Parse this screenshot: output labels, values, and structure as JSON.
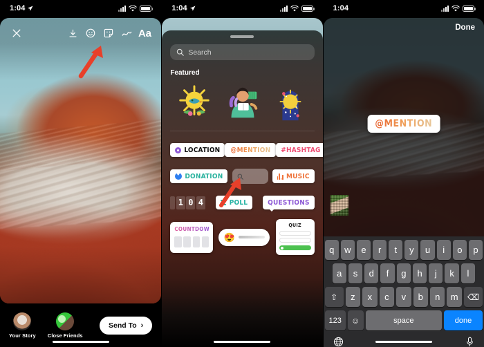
{
  "status_bar": {
    "time": "1:04",
    "location_arrow": true,
    "signal_icon": "signal-bars-icon",
    "wifi_icon": "wifi-icon",
    "battery_icon": "battery-icon"
  },
  "panel1": {
    "name": "instagram-story-editor",
    "toolbar": {
      "close_label": "✕",
      "items": [
        {
          "name": "close-icon",
          "label": "✕"
        },
        {
          "name": "download-icon",
          "label": "download"
        },
        {
          "name": "emoji-face-icon",
          "label": "emoji"
        },
        {
          "name": "sticker-icon",
          "label": "sticker"
        },
        {
          "name": "draw-squiggle-icon",
          "label": "draw"
        },
        {
          "name": "text-aa-icon",
          "label": "Aa"
        }
      ],
      "text_tool_label": "Aa"
    },
    "photo_alt": "desert rock formation with teal sky",
    "share": {
      "your_story_label": "Your Story",
      "close_friends_label": "Close Friends",
      "send_to_label": "Send To",
      "send_to_chevron": "›"
    },
    "annotation": {
      "type": "red-arrow",
      "points_to": "sticker-icon"
    }
  },
  "panel2": {
    "name": "sticker-tray",
    "search": {
      "placeholder": "Search",
      "value": "",
      "icon": "search-icon"
    },
    "section_title": "Featured",
    "featured_stickers": [
      {
        "name": "sun-bird-sticker",
        "alt": "sun with bird"
      },
      {
        "name": "reading-person-sticker",
        "alt": "person reading"
      },
      {
        "name": "celestial-sun-moon-sticker",
        "alt": "sun and moon"
      }
    ],
    "sticker_rows": [
      [
        {
          "name": "location-sticker",
          "label": "LOCATION",
          "icon": "pin-icon",
          "color": "#111111"
        },
        {
          "name": "mention-sticker",
          "label": "@MENTION",
          "color": "#e8622e",
          "highlighted": true
        },
        {
          "name": "hashtag-sticker",
          "label": "#HASHTAG",
          "color": "#ef4f74"
        }
      ],
      [
        {
          "name": "donation-sticker",
          "label": "DONATION",
          "icon": "heart-icon",
          "color": "#2bb39f"
        },
        {
          "name": "gif-search-sticker",
          "label": "",
          "icon": "search-icon"
        },
        {
          "name": "music-sticker",
          "label": "MUSIC",
          "icon": "music-bars-icon",
          "color": "#ee7239"
        }
      ],
      [
        {
          "name": "counter-sticker",
          "label": "104"
        },
        {
          "name": "poll-sticker",
          "label": "POLL",
          "icon": "poll-icon",
          "color": "#24b3a4"
        },
        {
          "name": "questions-sticker",
          "label": "QUESTIONS",
          "color": "#8e5ad6"
        }
      ]
    ],
    "counter_digits": [
      "1",
      "0",
      "4"
    ],
    "cards": {
      "countdown_label": "COUNTDOWN",
      "slider_emoji": "😍",
      "quiz_label": "QUIZ"
    },
    "annotation": {
      "type": "red-arrow",
      "points_to": "mention-sticker"
    }
  },
  "panel3": {
    "name": "mention-placed-view",
    "done_label": "Done",
    "placed_sticker_label": "@MENTION",
    "thumbnail_name": "photo-thumbnail",
    "keyboard": {
      "row1": [
        "q",
        "w",
        "e",
        "r",
        "t",
        "y",
        "u",
        "i",
        "o",
        "p"
      ],
      "row2": [
        "a",
        "s",
        "d",
        "f",
        "g",
        "h",
        "j",
        "k",
        "l"
      ],
      "row3": [
        "z",
        "x",
        "c",
        "v",
        "b",
        "n",
        "m"
      ],
      "shift_label": "⇧",
      "backspace_label": "⌫",
      "numbers_label": "123",
      "emoji_label": "☺",
      "space_label": "space",
      "done_label": "done",
      "globe_icon": "globe-icon",
      "mic_icon": "microphone-icon"
    }
  },
  "colors": {
    "accent_blue": "#0a84ff",
    "mention_orange": "#e8622e",
    "hashtag_pink": "#ef4f74",
    "poll_teal": "#24b3a4",
    "questions_purple": "#8e5ad6",
    "quiz_green": "#4cc14f",
    "annotation_red": "#e8402a"
  }
}
